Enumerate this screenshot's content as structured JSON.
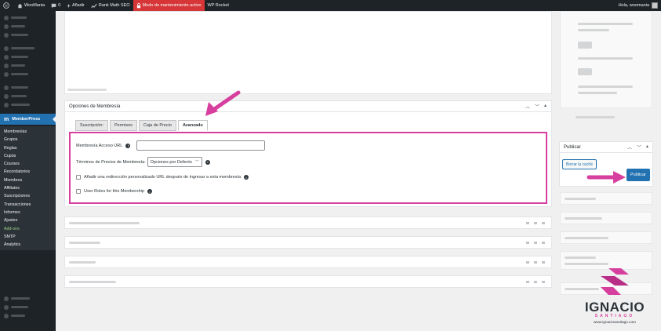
{
  "admin_bar": {
    "site_name": "WooMania",
    "comments_count": "0",
    "add_new": "Añadir",
    "rank_math": "Rank Math SEO",
    "maintenance": "Modo de mantenimiento activo",
    "wp_rocket": "WP Rocket",
    "greeting": "Hola, woomania"
  },
  "sidebar": {
    "active_menu": "MemberPress",
    "submenu": [
      "Membresías",
      "Grupos",
      "Reglas",
      "Cupós",
      "Courses",
      "Recordatorios",
      "Miembros",
      "Affiliates",
      "Suscripciones",
      "Transacciones",
      "Informes",
      "Ajustes",
      "Add-ons",
      "SMTP",
      "Analytics"
    ]
  },
  "membership_box": {
    "title": "Opciones de Membresía",
    "tabs": [
      "Suscripción:",
      "Permisos",
      "Caja de Precio",
      "Avanzado"
    ],
    "active_tab": "Avanzado",
    "access_url_label": "Membresía Acceso URL",
    "access_url_value": "",
    "pricing_terms_label": "Términos de Precios de Membresía:",
    "pricing_terms_value": "Opciones por Defecto",
    "redirect_label": "Añadir una redirección personalizado URL después de ingresar a esta membresía",
    "user_roles_label": "User Roles for this Membership"
  },
  "publish_box": {
    "title": "Publicar",
    "cache_button": "Borrar la caché",
    "publish_button": "Publicar"
  },
  "watermark": {
    "name": "IGNACIO",
    "sub": "SANTIAGO",
    "url": "www.ignaciosantiago.com"
  },
  "colors": {
    "admin_bar": "#1d2327",
    "accent_blue": "#2271b1",
    "highlight_pink": "#d63f9e",
    "maintenance_red": "#d63638"
  }
}
